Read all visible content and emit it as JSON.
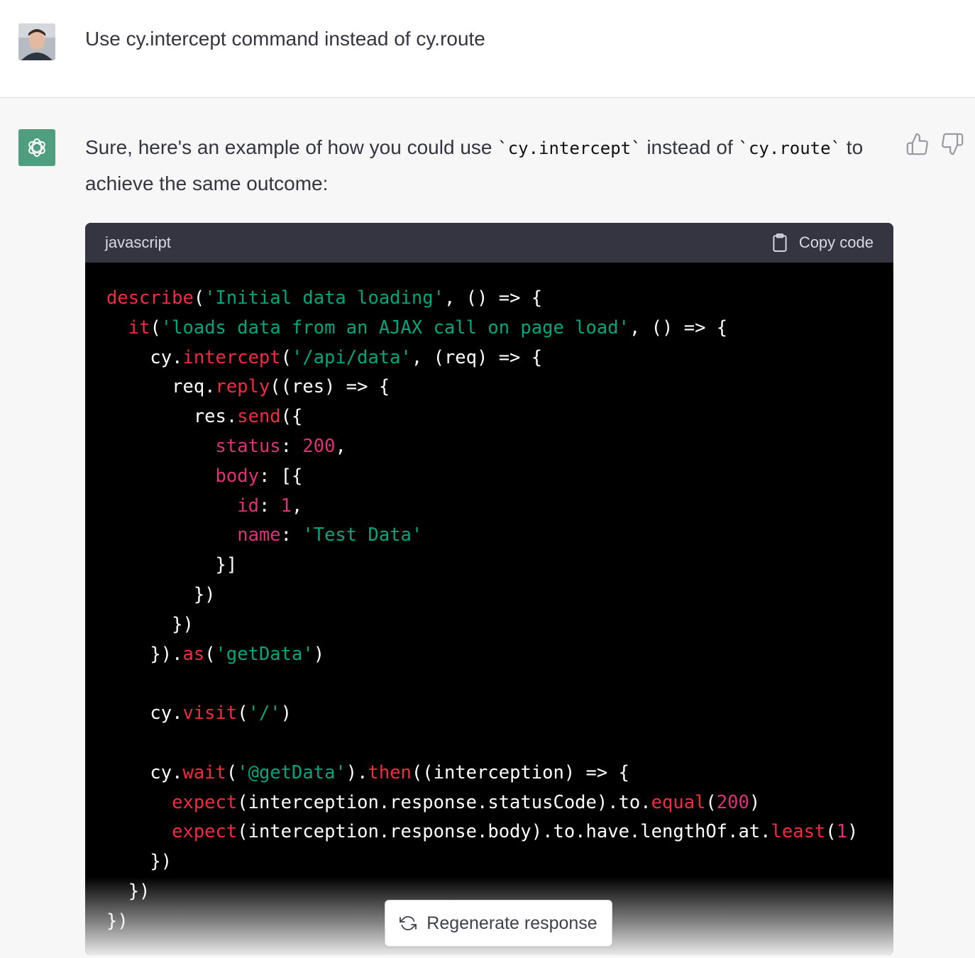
{
  "user": {
    "avatar": "user-avatar-photo",
    "message": "Use cy.intercept command instead of cy.route"
  },
  "assistant": {
    "avatar": "openai-logo",
    "intro_part1": "Sure, here's an example of how you could use ",
    "intro_code1": "`cy.intercept`",
    "intro_part2": " instead of ",
    "intro_code2": "`cy.route`",
    "intro_part3": " to achieve the same outcome:",
    "feedback": {
      "up_icon": "thumbs-up-icon",
      "down_icon": "thumbs-down-icon"
    }
  },
  "code_block": {
    "language": "javascript",
    "copy_label": "Copy code",
    "copy_icon": "clipboard-icon",
    "colors": {
      "function": "#f22c3d",
      "string": "#00a67d",
      "number": "#df3079",
      "property": "#df3079"
    },
    "lines": [
      [
        [
          "fn",
          "describe"
        ],
        [
          "p",
          "("
        ],
        [
          "str",
          "'Initial data loading'"
        ],
        [
          "p",
          ", () => {"
        ]
      ],
      [
        [
          "p",
          "  "
        ],
        [
          "fn",
          "it"
        ],
        [
          "p",
          "("
        ],
        [
          "str",
          "'loads data from an AJAX call on page load'"
        ],
        [
          "p",
          ", () => {"
        ]
      ],
      [
        [
          "p",
          "    cy."
        ],
        [
          "fn",
          "intercept"
        ],
        [
          "p",
          "("
        ],
        [
          "str",
          "'/api/data'"
        ],
        [
          "p",
          ", (req) => {"
        ]
      ],
      [
        [
          "p",
          "      req."
        ],
        [
          "fn",
          "reply"
        ],
        [
          "p",
          "((res) => {"
        ]
      ],
      [
        [
          "p",
          "        res."
        ],
        [
          "fn",
          "send"
        ],
        [
          "p",
          "({"
        ]
      ],
      [
        [
          "p",
          "          "
        ],
        [
          "key",
          "status"
        ],
        [
          "p",
          ": "
        ],
        [
          "num",
          "200"
        ],
        [
          "p",
          ","
        ]
      ],
      [
        [
          "p",
          "          "
        ],
        [
          "key",
          "body"
        ],
        [
          "p",
          ": [{"
        ]
      ],
      [
        [
          "p",
          "            "
        ],
        [
          "key",
          "id"
        ],
        [
          "p",
          ": "
        ],
        [
          "num",
          "1"
        ],
        [
          "p",
          ","
        ]
      ],
      [
        [
          "p",
          "            "
        ],
        [
          "key",
          "name"
        ],
        [
          "p",
          ": "
        ],
        [
          "str",
          "'Test Data'"
        ]
      ],
      [
        [
          "p",
          "          }]"
        ]
      ],
      [
        [
          "p",
          "        })"
        ]
      ],
      [
        [
          "p",
          "      })"
        ]
      ],
      [
        [
          "p",
          "    })."
        ],
        [
          "fn",
          "as"
        ],
        [
          "p",
          "("
        ],
        [
          "str",
          "'getData'"
        ],
        [
          "p",
          ")"
        ]
      ],
      [],
      [
        [
          "p",
          "    cy."
        ],
        [
          "fn",
          "visit"
        ],
        [
          "p",
          "("
        ],
        [
          "str",
          "'/'"
        ],
        [
          "p",
          ")"
        ]
      ],
      [],
      [
        [
          "p",
          "    cy."
        ],
        [
          "fn",
          "wait"
        ],
        [
          "p",
          "("
        ],
        [
          "str",
          "'@getData'"
        ],
        [
          "p",
          ")."
        ],
        [
          "fn",
          "then"
        ],
        [
          "p",
          "((interception) => {"
        ]
      ],
      [
        [
          "p",
          "      "
        ],
        [
          "fn",
          "expect"
        ],
        [
          "p",
          "(interception.response.statusCode).to."
        ],
        [
          "fn",
          "equal"
        ],
        [
          "p",
          "("
        ],
        [
          "num",
          "200"
        ],
        [
          "p",
          ")"
        ]
      ],
      [
        [
          "p",
          "      "
        ],
        [
          "fn",
          "expect"
        ],
        [
          "p",
          "(interception.response.body).to.have.lengthOf.at."
        ],
        [
          "fn",
          "least"
        ],
        [
          "p",
          "("
        ],
        [
          "num",
          "1"
        ],
        [
          "p",
          ")"
        ]
      ],
      [
        [
          "p",
          "    })"
        ]
      ],
      [
        [
          "p",
          "  })"
        ]
      ],
      [
        [
          "p",
          "})"
        ]
      ]
    ]
  },
  "regenerate": {
    "label": "Regenerate response",
    "icon": "refresh-icon"
  }
}
